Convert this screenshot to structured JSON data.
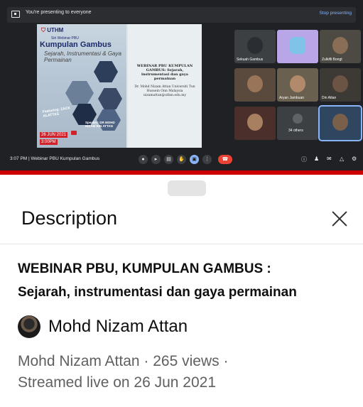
{
  "meet": {
    "presenting_text": "You're presenting to everyone",
    "stop_presenting": "Stop presenting",
    "clock_and_title": "3:07 PM  |  Webinar PBU Kumpulan Gambus",
    "slide": {
      "logo": "UTHM",
      "series": "Siri Webinar PBU",
      "title": "Kumpulan Gambus",
      "subtitle": "Sejarah, Instrumentasi & Gaya Permainan",
      "featuring": "Featuring: ZACK ALATTAS",
      "speaker": "Speaker: DR MOHD NIZAM BIN ATTAN",
      "date": "26 JUN 2021",
      "time": "3:00PM",
      "doc_title": "WEBINAR PBU KUMPULAN GAMBUS: Sejarah, instrumentasi dan gaya permainan",
      "doc_author": "Dr. Mohd Nizam Attan Universiti Tun Hussein Onn Malaysia nizamattan@uthm.edu.my"
    },
    "participants": [
      {
        "name": "Sekuah Gambus"
      },
      {
        "name": ""
      },
      {
        "name": "Zulkifli Bongt"
      },
      {
        "name": ""
      },
      {
        "name": "Aryan Jambuan"
      },
      {
        "name": "Din Attan"
      },
      {
        "name": ""
      },
      {
        "name": "34 others"
      },
      {
        "name": ""
      }
    ]
  },
  "sheet": {
    "title": "Description",
    "video_title_line1": "WEBINAR PBU, KUMPULAN GAMBUS :",
    "video_title_line2": "Sejarah, instrumentasi dan gaya permainan",
    "channel_name": "Mohd Nizam Attan",
    "meta_line1": "Mohd Nizam Attan · 265 views ·",
    "meta_line2": "Streamed live on 26 Jun 2021"
  },
  "colors": {
    "meet_bg": "#202124",
    "accent_blue": "#8ab4f8",
    "end_call_red": "#ea4335",
    "brand_red": "#cc0000"
  },
  "icons": [
    "present-icon",
    "mic-icon",
    "camera-icon",
    "captions-icon",
    "raise-hand-icon",
    "present-screen-icon",
    "more-icon",
    "end-call-icon",
    "info-icon",
    "people-icon",
    "chat-icon",
    "activities-icon",
    "lock-icon",
    "close-icon"
  ]
}
